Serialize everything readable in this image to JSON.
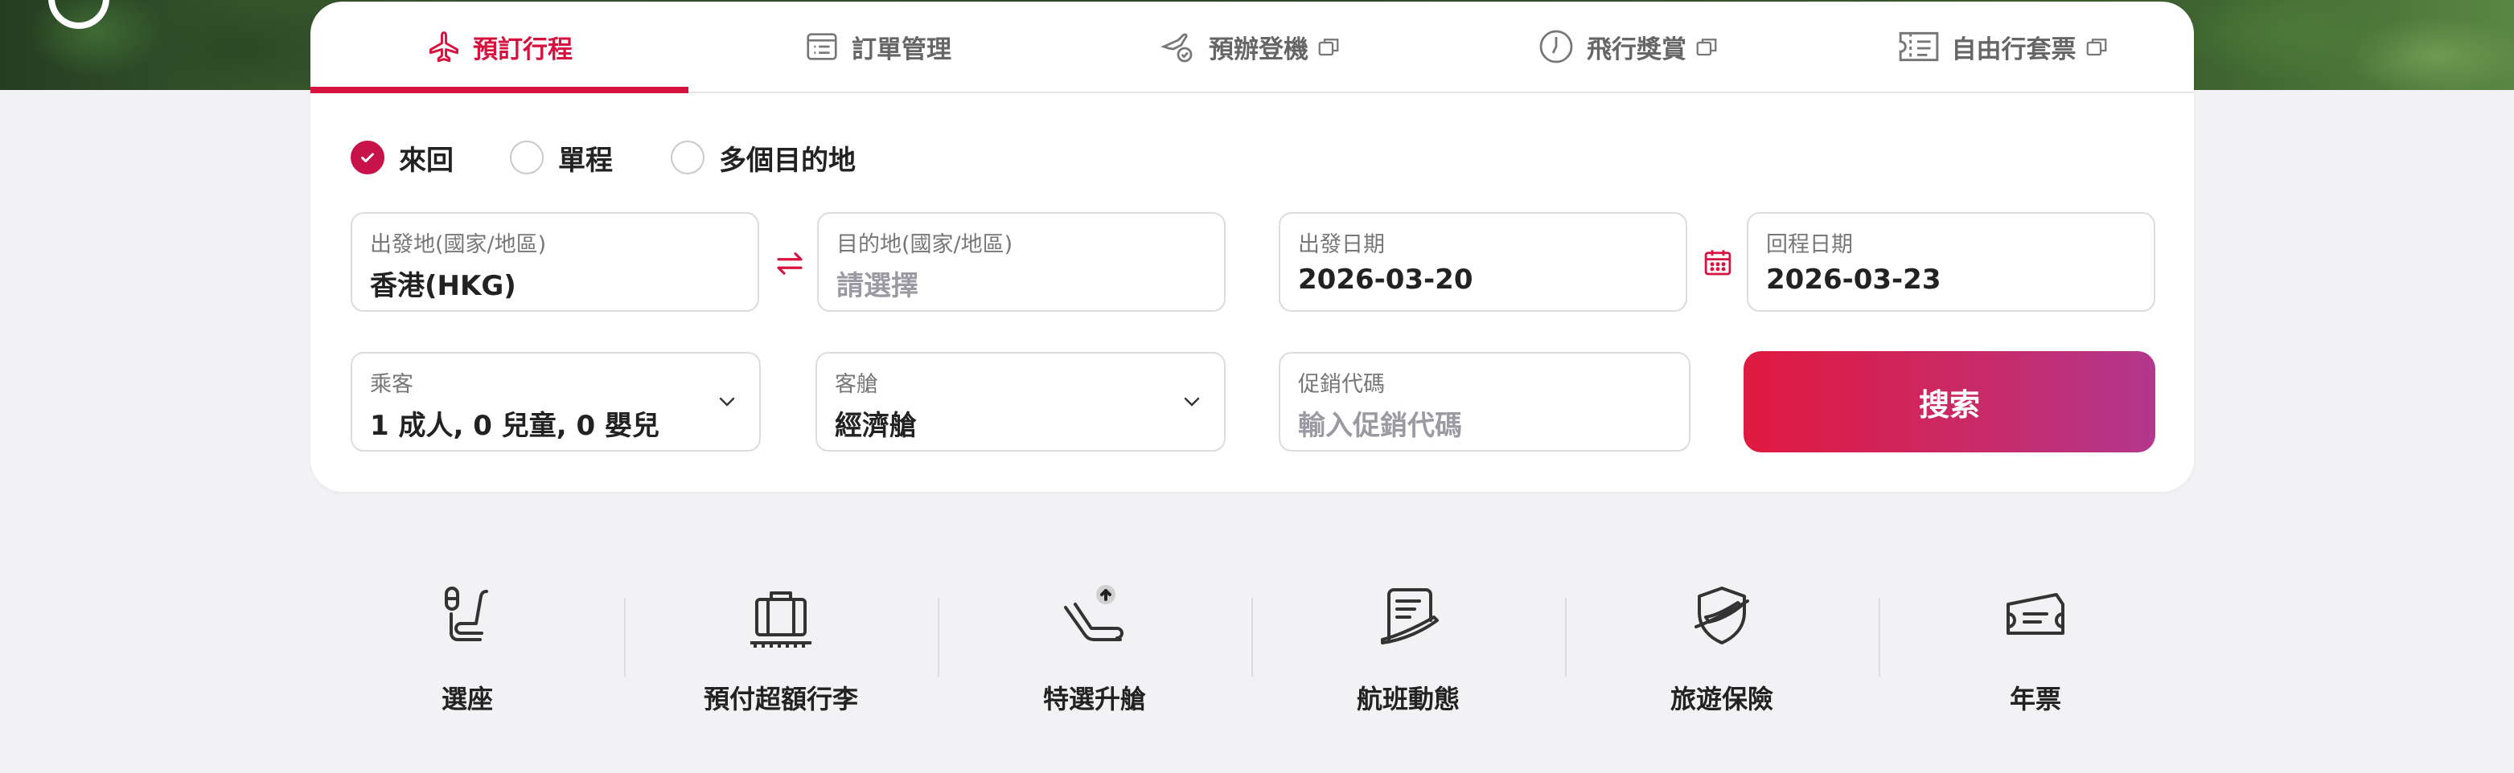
{
  "tabs": [
    {
      "label": "預訂行程",
      "icon": "airplane-icon",
      "active": true
    },
    {
      "label": "訂單管理",
      "icon": "list-icon",
      "active": false
    },
    {
      "label": "預辦登機",
      "icon": "checkin-icon",
      "active": false
    },
    {
      "label": "飛行獎賞",
      "icon": "rewards-clock-icon",
      "active": false
    },
    {
      "label": "自由行套票",
      "icon": "ticket-icon",
      "active": false
    }
  ],
  "trip_type": {
    "options": [
      "來回",
      "單程",
      "多個目的地"
    ],
    "selected": "來回"
  },
  "fields": {
    "origin": {
      "label": "出發地(國家/地區)",
      "value": "香港(HKG)"
    },
    "destination": {
      "label": "目的地(國家/地區)",
      "placeholder": "請選擇"
    },
    "depart_date": {
      "label": "出發日期",
      "value": "2026-03-20"
    },
    "return_date": {
      "label": "回程日期",
      "value": "2026-03-23"
    },
    "passengers": {
      "label": "乘客",
      "value": "1 成人, 0 兒童, 0 嬰兒"
    },
    "cabin": {
      "label": "客艙",
      "value": "經濟艙"
    },
    "promo": {
      "label": "促銷代碼",
      "placeholder": "輸入促銷代碼"
    }
  },
  "search_label": "搜索",
  "services": [
    {
      "label": "選座",
      "icon": "seat-icon"
    },
    {
      "label": "預付超額行李",
      "icon": "baggage-icon"
    },
    {
      "label": "特選升艙",
      "icon": "upgrade-seat-icon"
    },
    {
      "label": "航班動態",
      "icon": "flight-status-icon"
    },
    {
      "label": "旅遊保險",
      "icon": "insurance-shield-icon"
    },
    {
      "label": "年票",
      "icon": "annual-ticket-icon"
    }
  ],
  "colors": {
    "accent": "#d6123f",
    "button_start": "#e01940",
    "button_end": "#b3378e"
  }
}
